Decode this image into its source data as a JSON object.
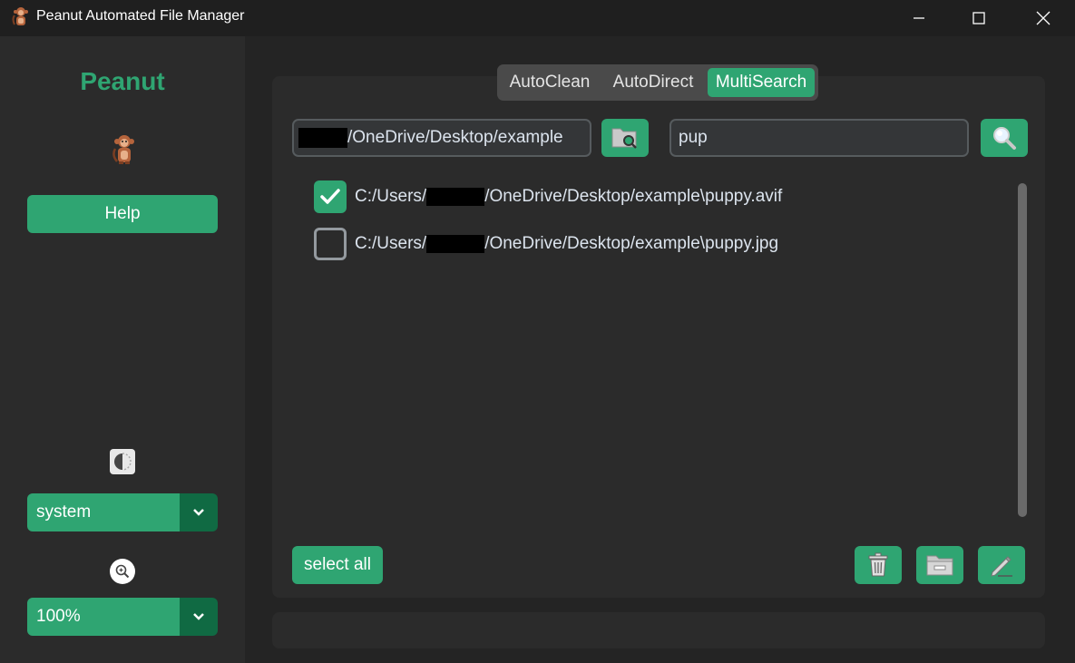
{
  "window": {
    "title": "Peanut Automated File Manager",
    "icons": {
      "app": "monkey-icon",
      "minimize": "minimize-icon",
      "maximize": "maximize-icon",
      "close": "close-icon"
    }
  },
  "sidebar": {
    "brand": "Peanut",
    "help_label": "Help",
    "appearance_value": "system",
    "scaling_value": "100%",
    "icons": {
      "logo": "monkey-icon",
      "theme": "theme-icon",
      "zoom": "zoom-icon",
      "dropdown": "chevron-down-icon"
    }
  },
  "tabs": [
    {
      "label": "AutoClean",
      "active": false
    },
    {
      "label": "AutoDirect",
      "active": false
    },
    {
      "label": "MultiSearch",
      "active": true
    }
  ],
  "multisearch": {
    "directory_suffix": "/OneDrive/Desktop/example",
    "search_value": "pup",
    "results": [
      {
        "prefix": "C:/Users/",
        "suffix": "/OneDrive/Desktop/example\\puppy.avif",
        "checked": true
      },
      {
        "prefix": "C:/Users/",
        "suffix": "/OneDrive/Desktop/example\\puppy.jpg",
        "checked": false
      }
    ],
    "select_all_label": "select all",
    "icons": {
      "browse": "folder-search-icon",
      "search": "search-icon",
      "delete": "trash-icon",
      "move": "folder-move-icon",
      "rename": "pencil-icon"
    }
  },
  "colors": {
    "accent": "#2fa572",
    "accent_dark": "#106a43",
    "background": "#242424",
    "panel": "#2b2b2b",
    "entry": "#343638"
  }
}
